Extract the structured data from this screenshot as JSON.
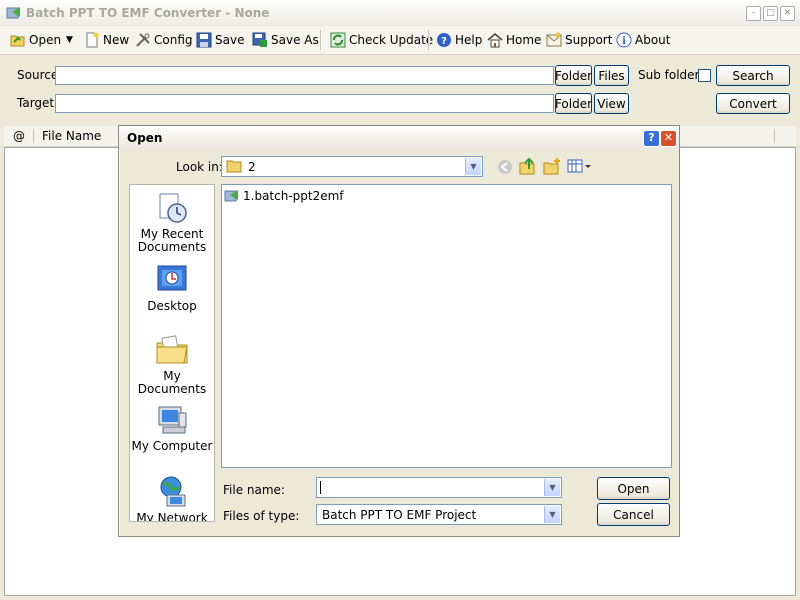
{
  "window": {
    "title": "Batch PPT TO EMF Converter - None",
    "controls": [
      "minimize",
      "maximize",
      "close"
    ]
  },
  "toolbar": {
    "open": "Open",
    "new": "New",
    "config": "Config",
    "save": "Save",
    "save_as": "Save As",
    "check_update": "Check Update",
    "help": "Help",
    "home": "Home",
    "support": "Support",
    "about": "About"
  },
  "source_panel": {
    "source_label": "Source",
    "target_label": "Target",
    "source_value": "",
    "target_value": "",
    "folder_button": "Folder",
    "files_button": "Files",
    "subfolders_label": "Sub folders",
    "subfolders_checked": false,
    "search_button": "Search",
    "target_folder_button": "Folder",
    "view_button": "View",
    "convert_button": "Convert"
  },
  "file_list": {
    "columns": [
      "@",
      "File Name"
    ]
  },
  "open_dialog": {
    "title": "Open",
    "look_in_label": "Look in:",
    "look_in_value": "2",
    "places": [
      "My Recent\nDocuments",
      "Desktop",
      "My Documents",
      "My Computer",
      "My Network"
    ],
    "files": [
      "1.batch-ppt2emf"
    ],
    "file_name_label": "File name:",
    "file_name_value": "",
    "files_of_type_label": "Files of type:",
    "files_of_type_value": "Batch PPT TO EMF Project",
    "open_button": "Open",
    "cancel_button": "Cancel"
  },
  "colors": {
    "accent": "#003c74",
    "dialog_close": "#d6512c",
    "dialog_help": "#3a6fd6"
  }
}
